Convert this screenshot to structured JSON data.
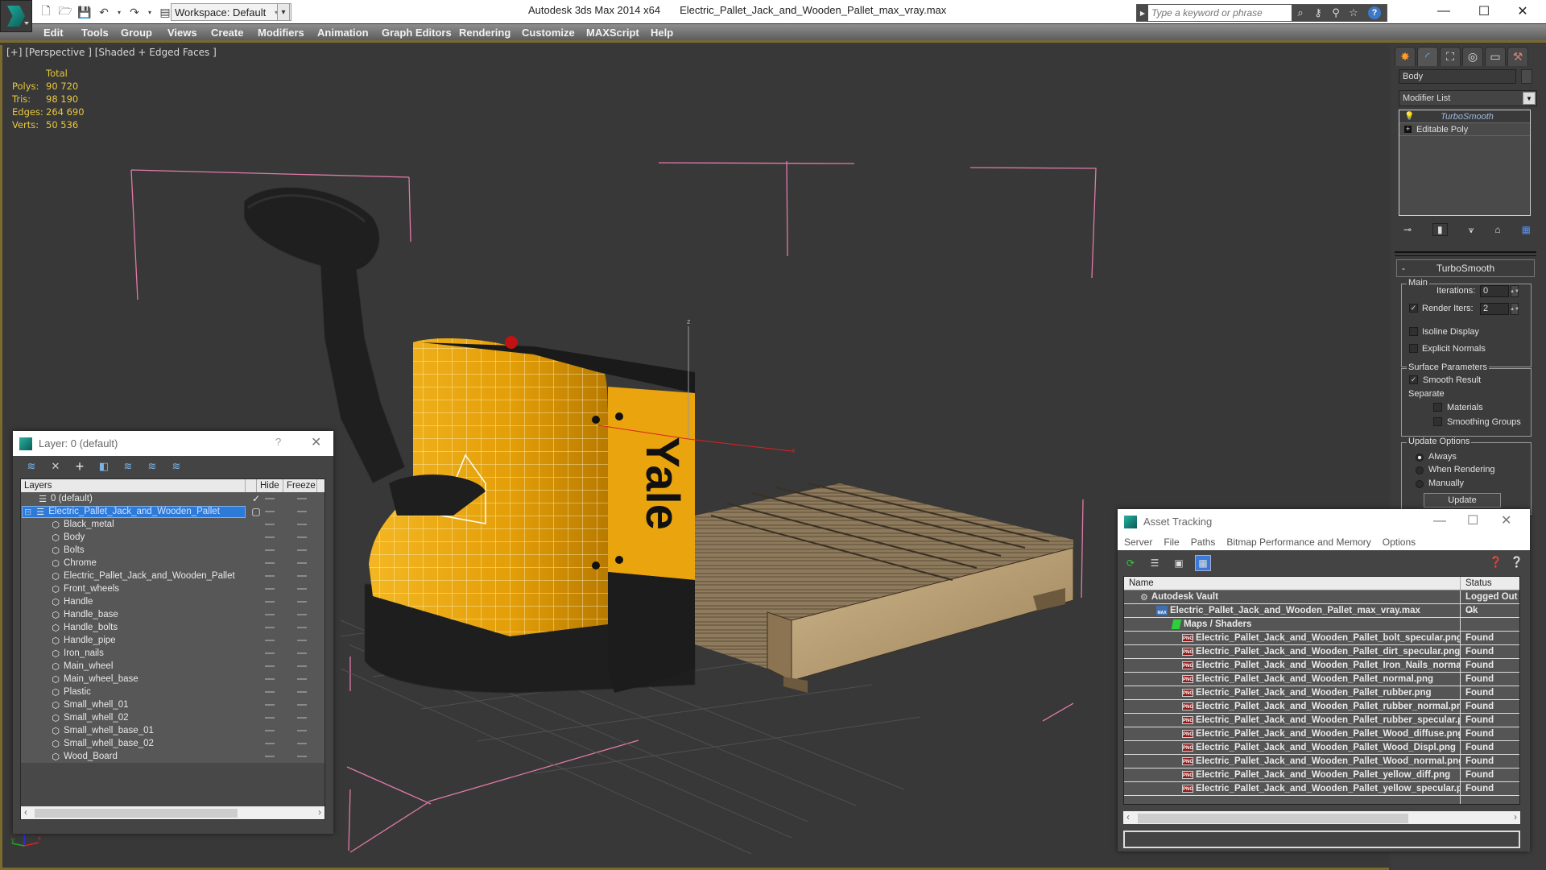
{
  "titlebar": {
    "app_name": "Autodesk 3ds Max  2014 x64",
    "file_name": "Electric_Pallet_Jack_and_Wooden_Pallet_max_vray.max",
    "workspace": "Workspace: Default",
    "search_placeholder": "Type a keyword or phrase",
    "quick_access": [
      "new-file-icon",
      "open-file-icon",
      "save-icon",
      "undo-icon",
      "redo-icon",
      "project-folder-icon"
    ],
    "search_tools": [
      "binoculars-icon",
      "key-icon",
      "satellite-icon",
      "star-icon",
      "help-icon"
    ],
    "window_controls": [
      "minimize",
      "maximize",
      "close"
    ]
  },
  "menubar": {
    "items": [
      "Edit",
      "Tools",
      "Group",
      "Views",
      "Create",
      "Modifiers",
      "Animation",
      "Graph Editors",
      "Rendering",
      "Customize",
      "MAXScript",
      "Help"
    ]
  },
  "viewport": {
    "label": "[+] [Perspective ] [Shaded + Edged Faces ]",
    "stats": {
      "header": "Total",
      "rows": [
        {
          "key": "Polys:",
          "value": "90 720"
        },
        {
          "key": "Tris:",
          "value": "98 190"
        },
        {
          "key": "Edges:",
          "value": "264 690"
        },
        {
          "key": "Verts:",
          "value": "50 536"
        }
      ]
    },
    "logo_text": "Yale",
    "axis_labels": {
      "x": "x",
      "y": "y",
      "z": "z"
    },
    "colors": {
      "body_yellow": "#e8a30c",
      "bbox_pink": "#e07aa8",
      "wood": "#b79a6a",
      "black_parts": "#1e1e1e"
    }
  },
  "command_panel": {
    "tabs": [
      "create-icon",
      "modify-icon",
      "hierarchy-icon",
      "motion-icon",
      "display-icon",
      "utilities-icon"
    ],
    "object_name": "Body",
    "modifier_list": "Modifier List",
    "stack": [
      {
        "label": "TurboSmooth",
        "active": true
      },
      {
        "label": "Editable Poly",
        "active": false
      }
    ],
    "turbosmooth": {
      "title": "TurboSmooth",
      "main_group": "Main",
      "iterations_label": "Iterations:",
      "iterations": "0",
      "render_iters_label": "Render Iters:",
      "render_iters": "2",
      "render_iters_checked": true,
      "isoline_display": "Isoline Display",
      "explicit_normals": "Explicit Normals",
      "surface_group": "Surface Parameters",
      "smooth_result": "Smooth Result",
      "separate": "Separate",
      "materials": "Materials",
      "smoothing_groups": "Smoothing Groups",
      "update_group": "Update Options",
      "always": "Always",
      "when_rendering": "When Rendering",
      "manually": "Manually",
      "update_button": "Update"
    }
  },
  "layer_dialog": {
    "title": "Layer: 0 (default)",
    "help": "?",
    "columns": [
      "Layers",
      "",
      "Hide",
      "Freeze"
    ],
    "layers": [
      {
        "name": "0 (default)",
        "type": "layer",
        "level": 1,
        "current": true
      },
      {
        "name": "Electric_Pallet_Jack_and_Wooden_Pallet",
        "type": "layer",
        "level": 1,
        "selected": true
      }
    ],
    "objects": [
      "Black_metal",
      "Body",
      "Bolts",
      "Chrome",
      "Electric_Pallet_Jack_and_Wooden_Pallet",
      "Front_wheels",
      "Handle",
      "Handle_base",
      "Handle_bolts",
      "Handle_pipe",
      "Iron_nails",
      "Main_wheel",
      "Main_wheel_base",
      "Plastic",
      "Small_whell_01",
      "Small_whell_02",
      "Small_whell_base_01",
      "Small_whell_base_02",
      "Wood_Board"
    ]
  },
  "asset_dialog": {
    "title": "Asset Tracking",
    "menu": [
      "Server",
      "File",
      "Paths",
      "Bitmap Performance and Memory",
      "Options"
    ],
    "columns": [
      "Name",
      "Status"
    ],
    "rows": [
      {
        "name": "Autodesk Vault",
        "status": "Logged Out ...",
        "type": "vault",
        "level": 0
      },
      {
        "name": "Electric_Pallet_Jack_and_Wooden_Pallet_max_vray.max",
        "status": "Ok",
        "type": "max",
        "level": 1
      },
      {
        "name": "Maps / Shaders",
        "status": "",
        "type": "maps",
        "level": 2
      },
      {
        "name": "Electric_Pallet_Jack_and_Wooden_Pallet_bolt_specular.png",
        "status": "Found",
        "type": "png",
        "level": 3
      },
      {
        "name": "Electric_Pallet_Jack_and_Wooden_Pallet_dirt_specular.png",
        "status": "Found",
        "type": "png",
        "level": 3
      },
      {
        "name": "Electric_Pallet_Jack_and_Wooden_Pallet_Iron_Nails_normal.png",
        "status": "Found",
        "type": "png",
        "level": 3
      },
      {
        "name": "Electric_Pallet_Jack_and_Wooden_Pallet_normal.png",
        "status": "Found",
        "type": "png",
        "level": 3
      },
      {
        "name": "Electric_Pallet_Jack_and_Wooden_Pallet_rubber.png",
        "status": "Found",
        "type": "png",
        "level": 3
      },
      {
        "name": "Electric_Pallet_Jack_and_Wooden_Pallet_rubber_normal.png",
        "status": "Found",
        "type": "png",
        "level": 3
      },
      {
        "name": "Electric_Pallet_Jack_and_Wooden_Pallet_rubber_specular.png",
        "status": "Found",
        "type": "png",
        "level": 3
      },
      {
        "name": "Electric_Pallet_Jack_and_Wooden_Pallet_Wood_diffuse.png",
        "status": "Found",
        "type": "png",
        "level": 3
      },
      {
        "name": "Electric_Pallet_Jack_and_Wooden_Pallet_Wood_Displ.png",
        "status": "Found",
        "type": "png",
        "level": 3
      },
      {
        "name": "Electric_Pallet_Jack_and_Wooden_Pallet_Wood_normal.png",
        "status": "Found",
        "type": "png",
        "level": 3
      },
      {
        "name": "Electric_Pallet_Jack_and_Wooden_Pallet_yellow_diff.png",
        "status": "Found",
        "type": "png",
        "level": 3
      },
      {
        "name": "Electric_Pallet_Jack_and_Wooden_Pallet_yellow_specular.png",
        "status": "Found",
        "type": "png",
        "level": 3
      }
    ]
  }
}
